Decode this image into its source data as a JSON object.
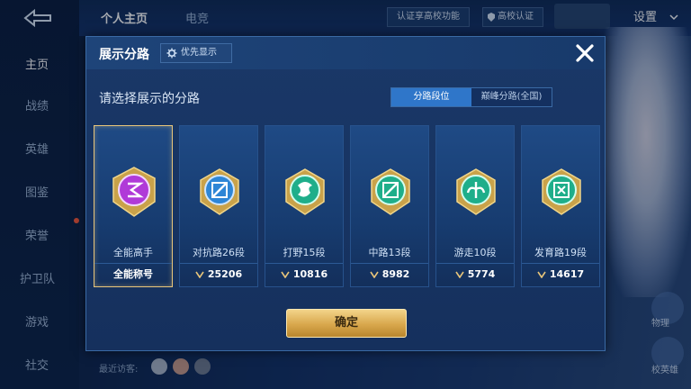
{
  "nav": {
    "items": [
      {
        "label": "主页",
        "active": true
      },
      {
        "label": "战绩"
      },
      {
        "label": "英雄"
      },
      {
        "label": "图鉴"
      },
      {
        "label": "荣誉"
      },
      {
        "label": "护卫队"
      },
      {
        "label": "游戏"
      },
      {
        "label": "社交"
      }
    ]
  },
  "top": {
    "tab_profile": "个人主页",
    "tab_esports": "电竞",
    "verify_label": "认证享高校功能",
    "campus_label": "高校认证",
    "settings_label": "设置"
  },
  "right_side": {
    "label_1": "物理",
    "label_2": "校英雄"
  },
  "bottom": {
    "visitors_label": "最近访客:"
  },
  "modal": {
    "title": "展示分路",
    "priority_label": "优先显示",
    "subtitle": "请选择展示的分路",
    "toggle": {
      "active": "分路段位",
      "inactive": "巅峰分路(全国)"
    },
    "cards": [
      {
        "label": "全能高手",
        "value": "全能称号",
        "selected": true,
        "emblem": "all-round-emblem-icon",
        "color": "#b03ad8"
      },
      {
        "label": "对抗路26段",
        "value": "25206",
        "emblem": "clash-lane-emblem-icon",
        "color": "#2e86d6"
      },
      {
        "label": "打野15段",
        "value": "10816",
        "emblem": "jungle-emblem-icon",
        "color": "#1fae8a"
      },
      {
        "label": "中路13段",
        "value": "8982",
        "emblem": "mid-lane-emblem-icon",
        "color": "#1fae8a"
      },
      {
        "label": "游走10段",
        "value": "5774",
        "emblem": "roam-emblem-icon",
        "color": "#1fae8a"
      },
      {
        "label": "发育路19段",
        "value": "14617",
        "emblem": "farm-lane-emblem-icon",
        "color": "#1fae8a"
      }
    ],
    "confirm_label": "确定"
  },
  "colors": {
    "accent_gold": "#e8c57a",
    "toggle_active": "#2f76c9",
    "close_icon": "#ffffff"
  }
}
